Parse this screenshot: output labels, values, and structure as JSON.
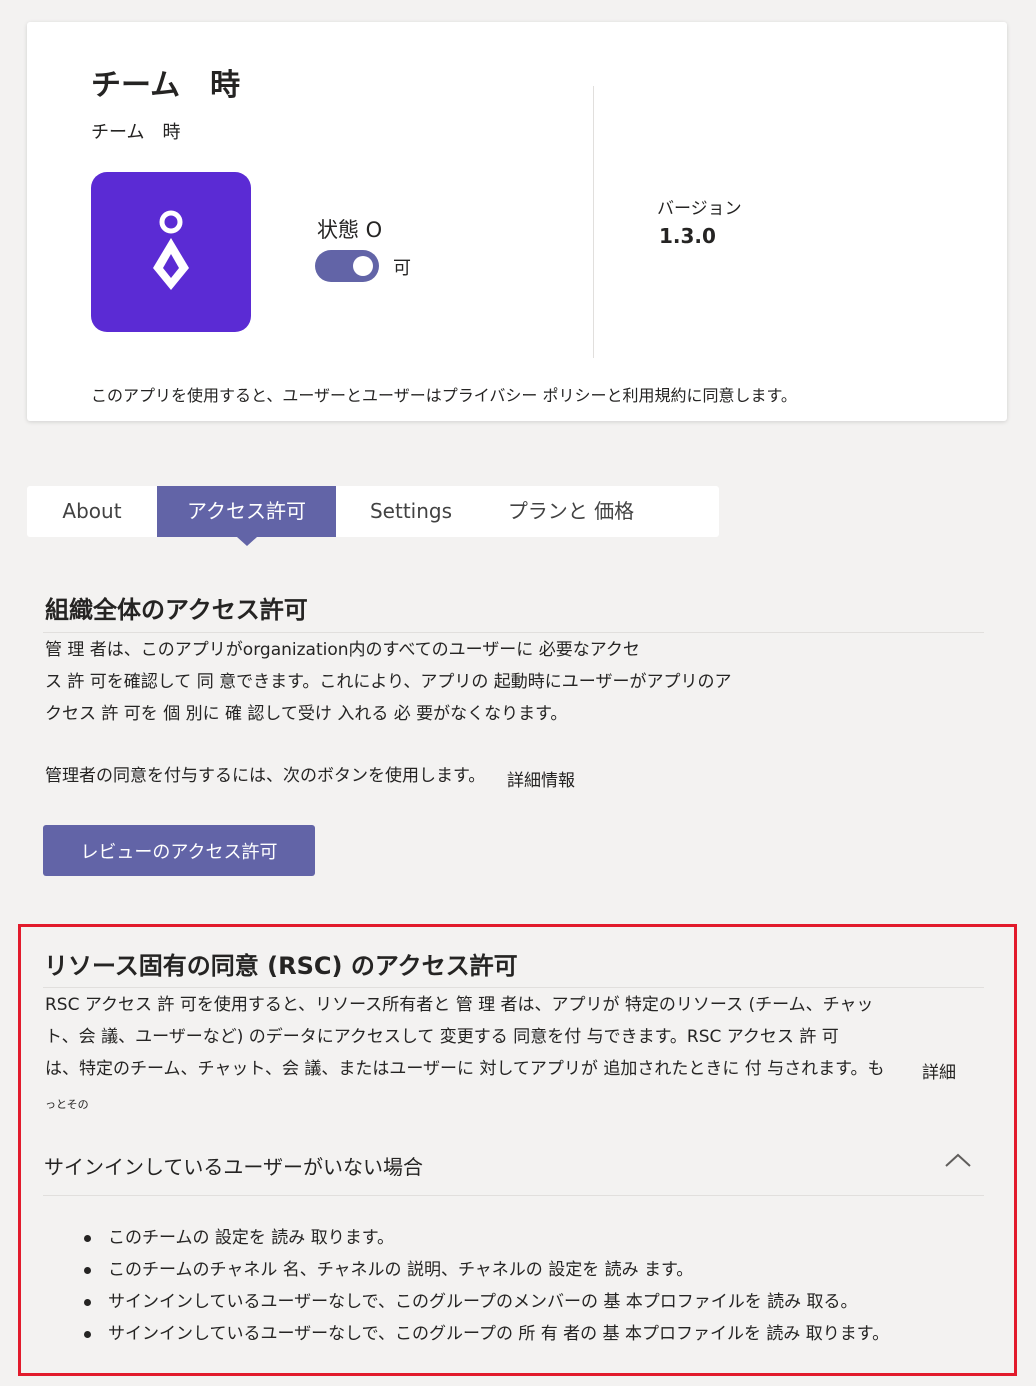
{
  "app": {
    "title": "チーム　時",
    "subtitle": "チーム　時",
    "icon": "app-logo-icon",
    "status_label": "状態 O",
    "toggle_text": "可",
    "version_label": "バージョン",
    "version_value": "1.3.0",
    "consent_text": "このアプリを使用すると、ユーザーとユーザーはプライバシー ポリシーと利用規約に同意します。"
  },
  "tabs": [
    {
      "label": "About"
    },
    {
      "label": "アクセス許可"
    },
    {
      "label": "Settings"
    },
    {
      "label": "プランと 価格"
    }
  ],
  "org": {
    "title": "組織全体のアクセス許可",
    "lines": [
      "管 理 者は、このアプリがorganization内のすべてのユーザーに 必要なアクセ",
      "ス 許 可を確認して 同 意できます。これにより、アプリの 起動時にユーザーがアプリのア",
      "クセス 許 可を 個 別に 確 認して受け 入れる 必 要がなくなります。"
    ],
    "grant_text": "管理者の同意を付与するには、次のボタンを使用します。",
    "learn_more": "詳細情報",
    "button_label": "レビューのアクセス許可"
  },
  "rsc": {
    "title": "リソース固有の同意 (RSC) のアクセス許可",
    "lines": [
      "RSC アクセス 許 可を使用すると、リソース所有者と 管 理 者は、アプリが 特定のリソース (チーム、チャッ",
      "ト、会 議、ユーザーなど) のデータにアクセスして 変更する 同意を付 与できます。RSC アクセス 許 可",
      "は、特定のチーム、チャット、会 議、またはユーザーに 対してアプリが 追加されたときに 付 与されます。も"
    ],
    "tail": "っとその",
    "learn_more": "詳細",
    "subheading": "サインインしているユーザーがいない場合",
    "items": [
      "このチームの 設定を 読み 取ります。",
      "このチームのチャネル 名、チャネルの 説明、チャネルの 設定を 読み ます。",
      "サインインしているユーザーなしで、このグループのメンバーの 基 本プロファイルを 読み 取る。",
      "サインインしているユーザーなしで、このグループの 所 有 者の 基 本プロファイルを 読み 取ります。"
    ]
  },
  "colors": {
    "accent": "#6264a7",
    "app_icon_bg": "#5b2bd4",
    "highlight_border": "#e21b2c",
    "page_bg": "#f3f2f1"
  }
}
